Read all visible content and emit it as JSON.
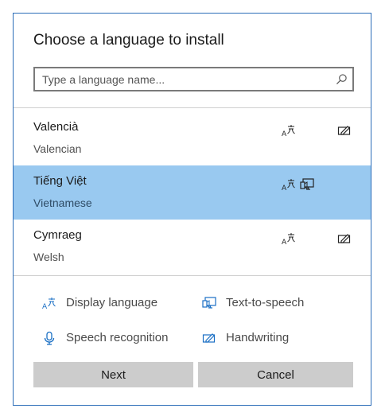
{
  "dialog": {
    "title": "Choose a language to install",
    "search": {
      "placeholder": "Type a language name...",
      "value": ""
    }
  },
  "languages": [
    {
      "native": "Valencià",
      "english": "Valencian",
      "selected": false,
      "features": [
        "display-language",
        "handwriting"
      ]
    },
    {
      "native": "Tiếng Việt",
      "english": "Vietnamese",
      "selected": true,
      "features": [
        "display-language",
        "text-to-speech"
      ]
    },
    {
      "native": "Cymraeg",
      "english": "Welsh",
      "selected": false,
      "features": [
        "display-language",
        "handwriting"
      ]
    }
  ],
  "legend": {
    "display_language": "Display language",
    "text_to_speech": "Text-to-speech",
    "speech_recognition": "Speech recognition",
    "handwriting": "Handwriting"
  },
  "buttons": {
    "next": "Next",
    "cancel": "Cancel"
  },
  "colors": {
    "selected_row": "#99c9f0",
    "icon_blue": "#1a6fc4",
    "border_accent": "#2b6cb8",
    "button_gray": "#cccccc"
  },
  "icons": [
    "search-icon",
    "display-language-icon",
    "text-to-speech-icon",
    "speech-recognition-icon",
    "handwriting-icon"
  ]
}
